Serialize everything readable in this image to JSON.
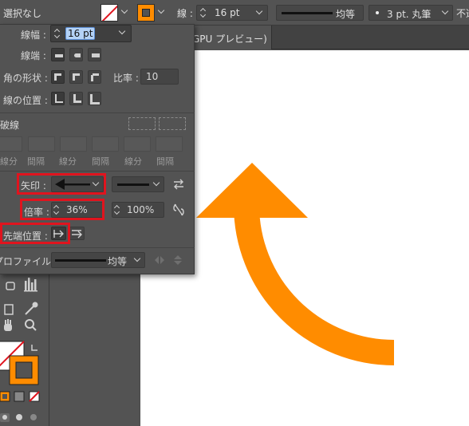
{
  "control_bar": {
    "selection_status": "選択なし",
    "stroke_label": "線 :",
    "stroke_weight": "16 pt",
    "profile_label": "均等",
    "brush_label": "3 pt. 丸筆",
    "opacity_label": "不透"
  },
  "document": {
    "tab_title": "GPU プレビュー)"
  },
  "stroke_panel": {
    "weight_label": "線幅 :",
    "weight_value": "16 pt",
    "cap_label": "線端 :",
    "corner_label": "角の形状 :",
    "limit_label": "比率 :",
    "limit_value": "10",
    "align_label": "線の位置 :",
    "dashed_label": "破線",
    "dash_labels": [
      "線分",
      "間隔",
      "線分",
      "間隔",
      "線分",
      "間隔"
    ],
    "arrow_label": "矢印 :",
    "scale_label": "倍率 :",
    "scale_start": "36%",
    "scale_end": "100%",
    "align_arrow_label": "先端位置 :",
    "profile_label": "プロファイル :",
    "profile_value": "均等"
  },
  "artwork": {
    "arrow_color": "#ff8c00"
  },
  "colors": {
    "highlight_red": "#e0141e",
    "fill_orange": "#ff8c00"
  }
}
